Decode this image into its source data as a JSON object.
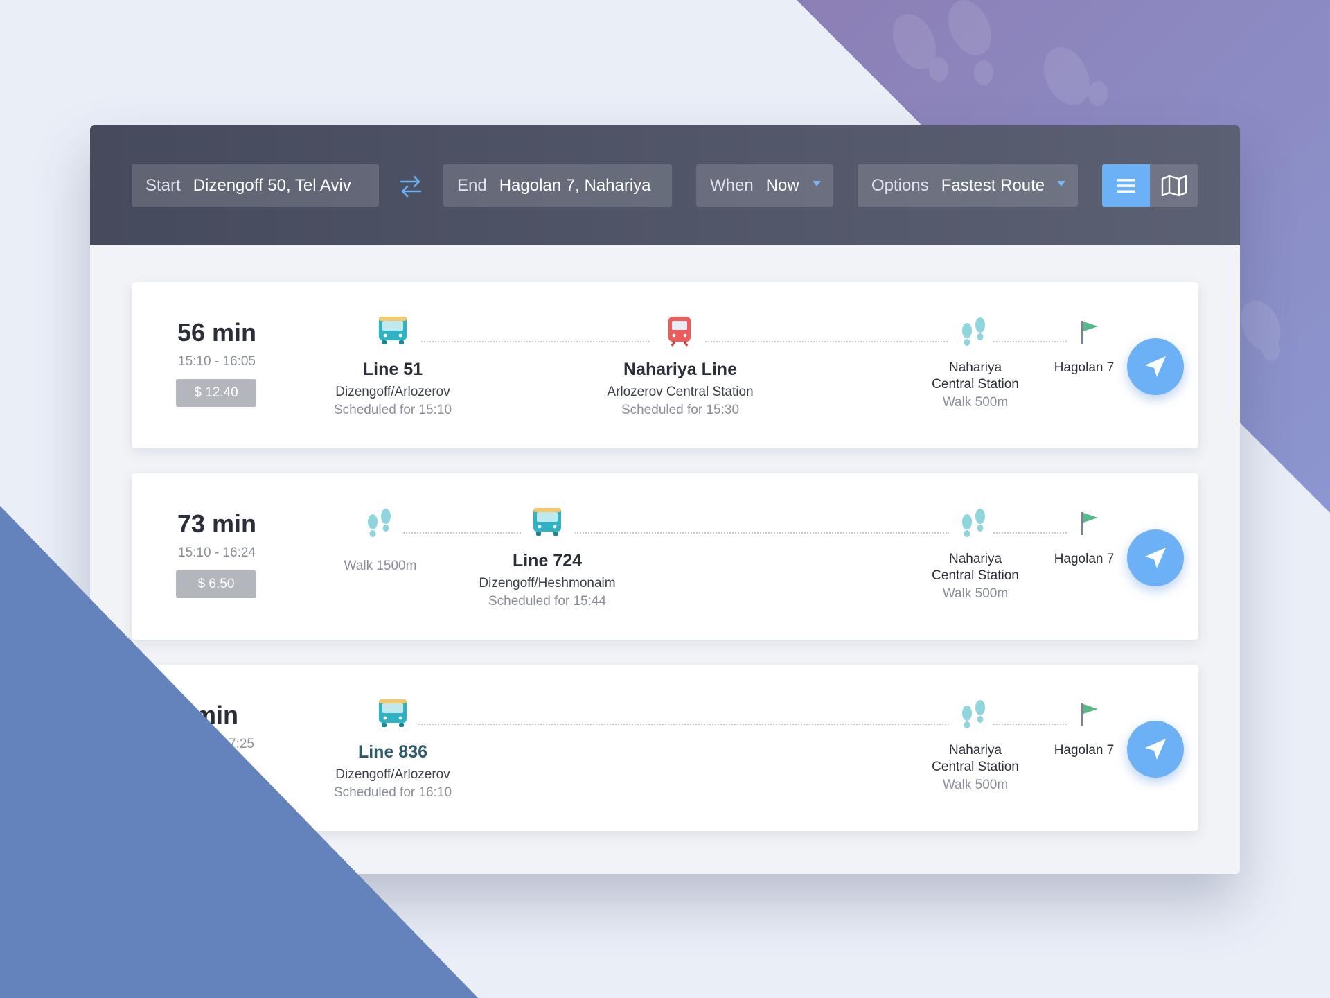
{
  "toolbar": {
    "start": {
      "label": "Start",
      "value": "Dizengoff 50, Tel Aviv"
    },
    "end": {
      "label": "End",
      "value": "Hagolan 7, Nahariya"
    },
    "when": {
      "label": "When",
      "value": "Now"
    },
    "options": {
      "label": "Options",
      "value": "Fastest Route"
    },
    "swap_icon": "swap-arrows-icon",
    "view_list_icon": "list-icon",
    "view_map_icon": "map-icon",
    "active_view": "list"
  },
  "routes": [
    {
      "duration": "56 min",
      "timespan": "15:10 - 16:05",
      "price": "$ 12.40",
      "legs": [
        {
          "icon": "bus-icon",
          "title": "Line 51",
          "sub": "Dizengoff/Arlozerov",
          "meta": "Scheduled for 15:10"
        },
        {
          "icon": "train-icon",
          "title": "Nahariya Line",
          "sub": "Arlozerov Central Station",
          "meta": "Scheduled for 15:30"
        },
        {
          "icon": "footsteps-icon",
          "name1": "Nahariya",
          "name2": "Central Station",
          "meta": "Walk 500m"
        },
        {
          "icon": "flag-icon",
          "name": "Hagolan 7"
        }
      ]
    },
    {
      "duration": "73 min",
      "timespan": "15:10 - 16:24",
      "price": "$ 6.50",
      "legs": [
        {
          "icon": "footsteps-icon",
          "meta": "Walk 1500m"
        },
        {
          "icon": "bus-icon",
          "title": "Line 724",
          "sub": "Dizengoff/Heshmonaim",
          "meta": "Scheduled for 15:44"
        },
        {
          "icon": "footsteps-icon",
          "name1": "Nahariya",
          "name2": "Central Station",
          "meta": "Walk 500m"
        },
        {
          "icon": "flag-icon",
          "name": "Hagolan 7"
        }
      ]
    },
    {
      "duration": "5 min",
      "timespan": "7:25",
      "legs": [
        {
          "icon": "bus-icon",
          "title": "Line 836",
          "sub": "Dizengoff/Arlozerov",
          "meta": "Scheduled for 16:10"
        },
        {
          "icon": "footsteps-icon",
          "name1": "Nahariya",
          "name2": "Central Station",
          "meta": "Walk 500m"
        },
        {
          "icon": "flag-icon",
          "name": "Hagolan 7"
        }
      ]
    }
  ],
  "nav_icon": "navigation-arrow-icon",
  "colors": {
    "toolbar_dark": "#454a5c",
    "accent_blue": "#6cb0f5",
    "bus_teal": "#2fb3c4",
    "train_red": "#ef5b5b",
    "footsteps": "#8fd6dc",
    "flag_green": "#55b98a",
    "bg_purple": "#8f86c4",
    "bg_blue": "#6483bd"
  }
}
